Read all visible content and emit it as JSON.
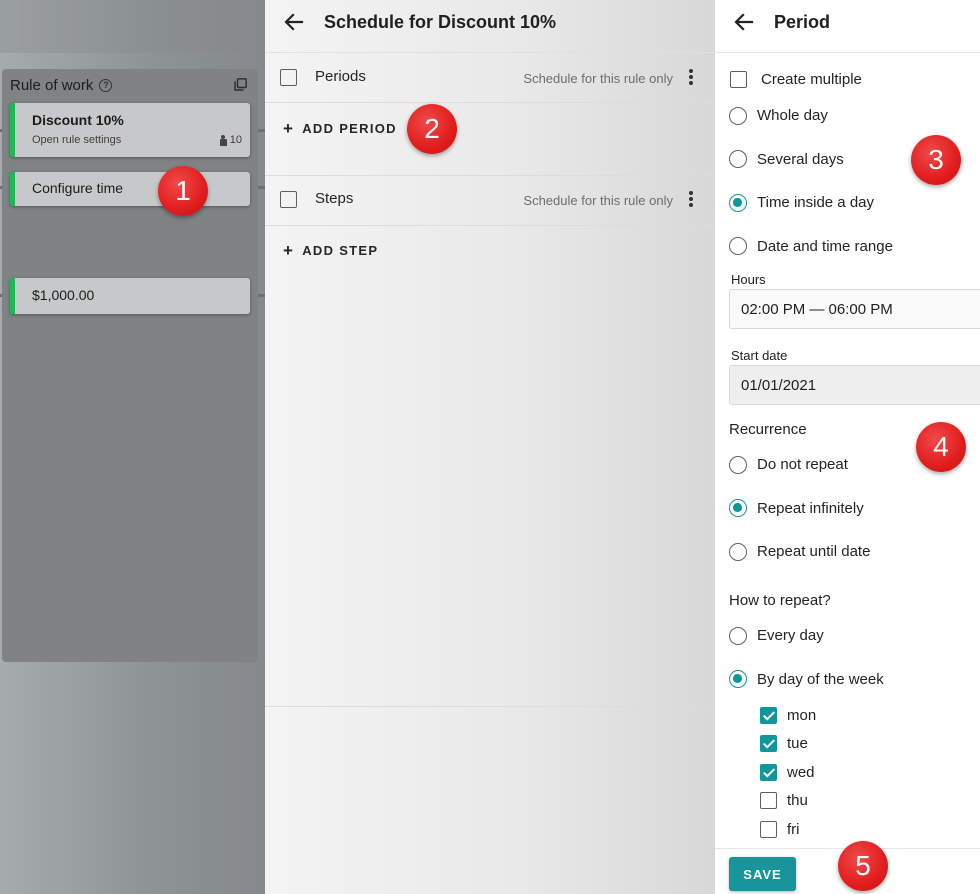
{
  "rule_panel": {
    "title": "Rule of work",
    "card_discount": {
      "title": "Discount 10%",
      "subtitle": "Open rule settings",
      "count": "10"
    },
    "card_time": {
      "title": "Configure time"
    },
    "card_amount": {
      "title": "$1,000.00"
    }
  },
  "schedule_panel": {
    "title": "Schedule for Discount 10%",
    "periods": {
      "label": "Periods",
      "scope": "Schedule for this rule only",
      "add_label": "ADD PERIOD"
    },
    "steps": {
      "label": "Steps",
      "scope": "Schedule for this rule only",
      "add_label": "ADD STEP"
    }
  },
  "period_panel": {
    "title": "Period",
    "create_multiple": {
      "label": "Create multiple",
      "checked": false
    },
    "period_types": [
      {
        "label": "Whole day",
        "selected": false
      },
      {
        "label": "Several days",
        "selected": false
      },
      {
        "label": "Time inside a day",
        "selected": true
      },
      {
        "label": "Date and time range",
        "selected": false
      }
    ],
    "hours": {
      "label": "Hours",
      "value": "02:00 PM — 06:00 PM"
    },
    "start_date": {
      "label": "Start date",
      "value": "01/01/2021"
    },
    "recurrence": {
      "label": "Recurrence",
      "options": [
        {
          "label": "Do not repeat",
          "selected": false
        },
        {
          "label": "Repeat infinitely",
          "selected": true
        },
        {
          "label": "Repeat until date",
          "selected": false
        }
      ]
    },
    "how_to_repeat": {
      "label": "How to repeat?",
      "options": [
        {
          "label": "Every day",
          "selected": false
        },
        {
          "label": "By day of the week",
          "selected": true
        }
      ]
    },
    "days": [
      {
        "label": "mon",
        "checked": true
      },
      {
        "label": "tue",
        "checked": true
      },
      {
        "label": "wed",
        "checked": true
      },
      {
        "label": "thu",
        "checked": false
      },
      {
        "label": "fri",
        "checked": false
      }
    ],
    "save_label": "SAVE"
  },
  "markers": [
    "1",
    "2",
    "3",
    "4",
    "5"
  ],
  "colors": {
    "accent": "#11969d",
    "rule_green": "#1db954",
    "marker_red": "#e11d1d"
  }
}
